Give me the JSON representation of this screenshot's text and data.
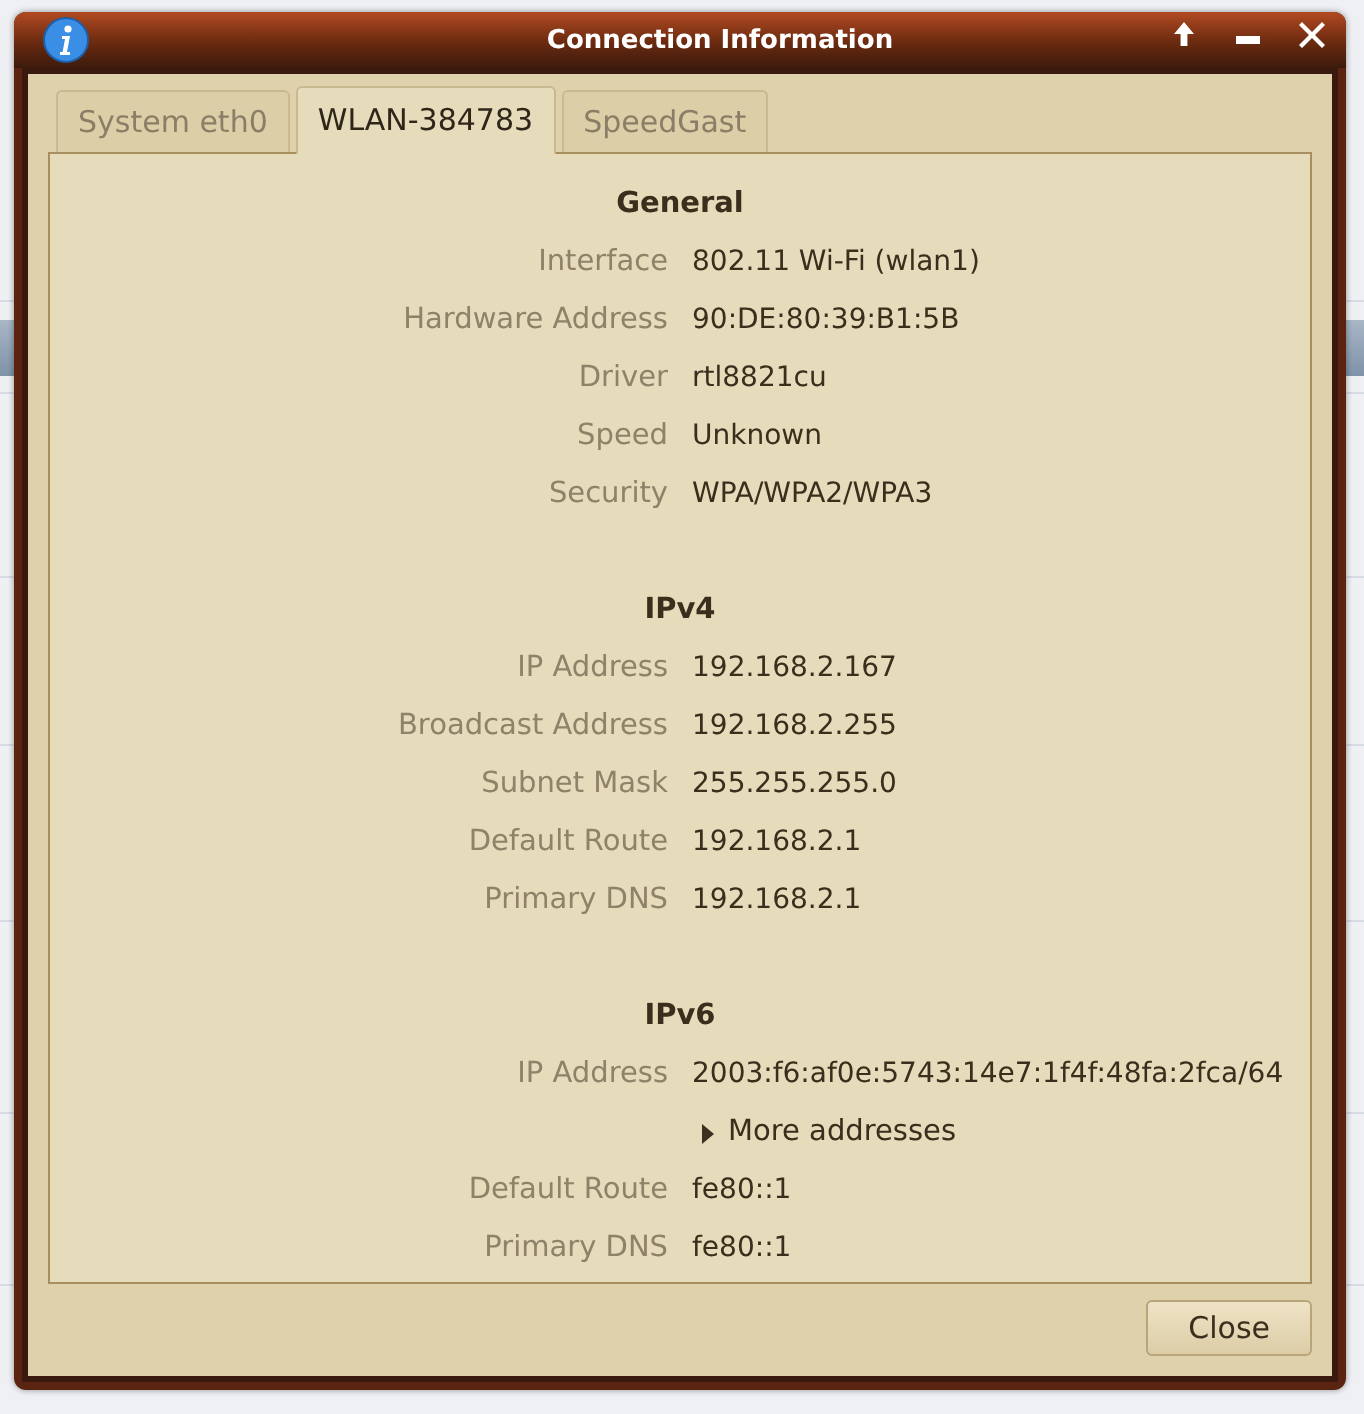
{
  "window": {
    "title": "Connection Information"
  },
  "tabs": [
    {
      "label": "System eth0",
      "selected": false
    },
    {
      "label": "WLAN-384783",
      "selected": true
    },
    {
      "label": "SpeedGast",
      "selected": false
    }
  ],
  "sections": [
    {
      "heading": "General",
      "rows": [
        {
          "kind": "field",
          "label": "Interface",
          "value": "802.11 Wi-Fi (wlan1)"
        },
        {
          "kind": "field",
          "label": "Hardware Address",
          "value": "90:DE:80:39:B1:5B"
        },
        {
          "kind": "field",
          "label": "Driver",
          "value": "rtl8821cu"
        },
        {
          "kind": "field",
          "label": "Speed",
          "value": "Unknown"
        },
        {
          "kind": "field",
          "label": "Security",
          "value": "WPA/WPA2/WPA3"
        }
      ]
    },
    {
      "heading": "IPv4",
      "rows": [
        {
          "kind": "field",
          "label": "IP Address",
          "value": "192.168.2.167"
        },
        {
          "kind": "field",
          "label": "Broadcast Address",
          "value": "192.168.2.255"
        },
        {
          "kind": "field",
          "label": "Subnet Mask",
          "value": "255.255.255.0"
        },
        {
          "kind": "field",
          "label": "Default Route",
          "value": "192.168.2.1"
        },
        {
          "kind": "field",
          "label": "Primary DNS",
          "value": "192.168.2.1"
        }
      ]
    },
    {
      "heading": "IPv6",
      "rows": [
        {
          "kind": "field",
          "label": "IP Address",
          "value": "2003:f6:af0e:5743:14e7:1f4f:48fa:2fca/64"
        },
        {
          "kind": "expander",
          "value": "More addresses",
          "expanded": false
        },
        {
          "kind": "field",
          "label": "Default Route",
          "value": "fe80::1"
        },
        {
          "kind": "field",
          "label": "Primary DNS",
          "value": "fe80::1"
        }
      ]
    }
  ],
  "buttons": [
    "Close"
  ]
}
